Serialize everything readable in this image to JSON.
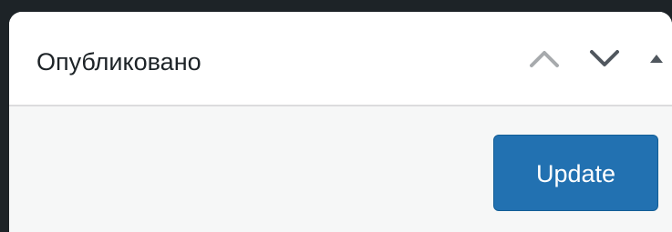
{
  "panel": {
    "title": "Опубликовано",
    "controls": {
      "move_up_icon": "chevron-up-icon",
      "move_down_icon": "chevron-down-icon",
      "toggle_icon": "triangle-up-icon"
    }
  },
  "actions": {
    "update_label": "Update"
  },
  "colors": {
    "page_background": "#1d2327",
    "header_background": "#ffffff",
    "body_background": "#f6f7f7",
    "primary_button": "#2271b1",
    "icon_muted": "#a7aaad",
    "icon_dark": "#50575e"
  }
}
